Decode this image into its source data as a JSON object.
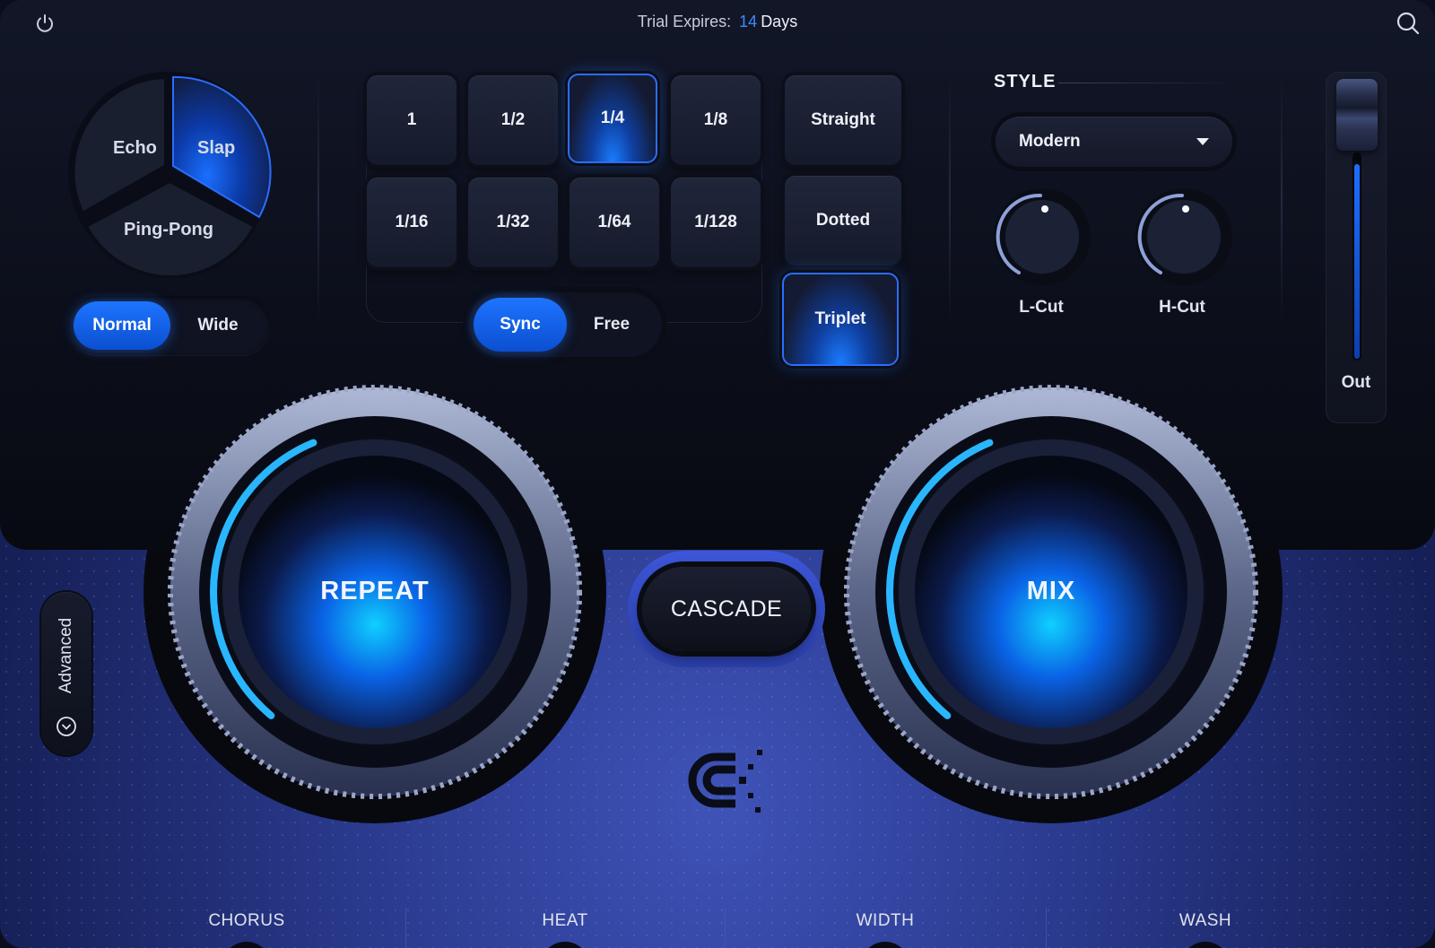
{
  "header": {
    "trial_prefix": "Trial Expires:",
    "trial_days_value": "14",
    "trial_days_unit": "Days"
  },
  "mode_selector": {
    "segments": [
      "Echo",
      "Slap",
      "Ping-Pong"
    ],
    "selected": "Slap"
  },
  "stereo_toggle": {
    "options": [
      "Normal",
      "Wide"
    ],
    "selected": "Normal"
  },
  "note_grid": {
    "values": [
      "1",
      "1/2",
      "1/4",
      "1/8",
      "1/16",
      "1/32",
      "1/64",
      "1/128"
    ],
    "selected": "1/4"
  },
  "timing_mode": {
    "options": [
      "Straight",
      "Dotted",
      "Triplet"
    ],
    "selected": "Triplet"
  },
  "sync_toggle": {
    "options": [
      "Sync",
      "Free"
    ],
    "selected": "Sync"
  },
  "style": {
    "label": "STYLE",
    "selected": "Modern"
  },
  "filters": {
    "low_cut_label": "L-Cut",
    "high_cut_label": "H-Cut"
  },
  "output": {
    "label": "Out",
    "level": 0.95
  },
  "main_knobs": {
    "repeat_label": "REPEAT",
    "repeat_value": 0.42,
    "mix_label": "MIX",
    "mix_value": 0.42
  },
  "cascade_label": "CASCADE",
  "advanced_label": "Advanced",
  "bottom_sections": [
    "CHORUS",
    "HEAT",
    "WIDTH",
    "WASH"
  ],
  "colors": {
    "accent": "#1e74ff",
    "arc": "#29b6ff",
    "background_bottom": "#2a3a8e",
    "panel_dark": "#0c0f1b"
  },
  "icons": {
    "power": "power-icon",
    "search": "search-icon",
    "dropdown": "chevron-down-icon",
    "advanced": "chevron-down-circle-icon",
    "logo": "brand-logo"
  }
}
